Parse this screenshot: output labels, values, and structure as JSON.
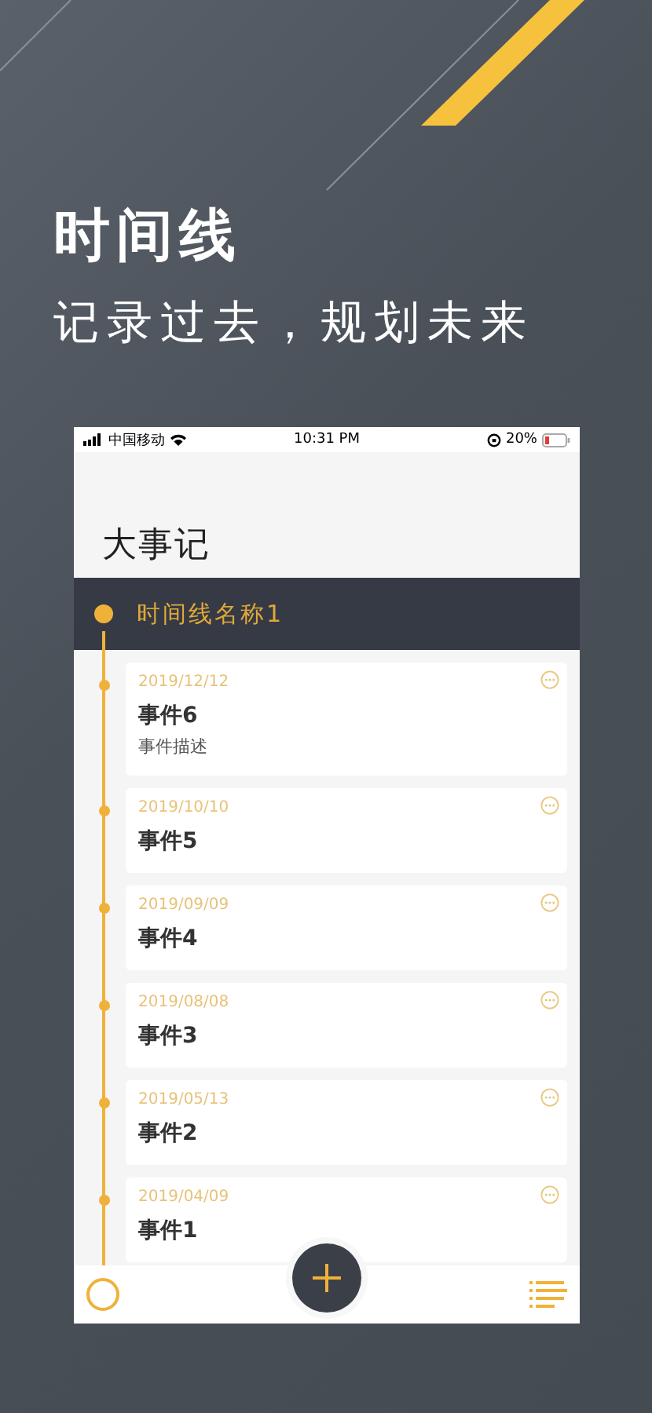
{
  "promo": {
    "title": "时间线",
    "subtitle": "记录过去，规划未来"
  },
  "status_bar": {
    "carrier": "中国移动",
    "time": "10:31 PM",
    "battery": "20%"
  },
  "header": {
    "title": "大事记"
  },
  "timeline": {
    "name": "时间线名称1"
  },
  "events": [
    {
      "date": "2019/12/12",
      "title": "事件6",
      "description": "事件描述"
    },
    {
      "date": "2019/10/10",
      "title": "事件5"
    },
    {
      "date": "2019/09/09",
      "title": "事件4"
    },
    {
      "date": "2019/08/08",
      "title": "事件3"
    },
    {
      "date": "2019/05/13",
      "title": "事件2"
    },
    {
      "date": "2019/04/09",
      "title": "事件1"
    }
  ]
}
